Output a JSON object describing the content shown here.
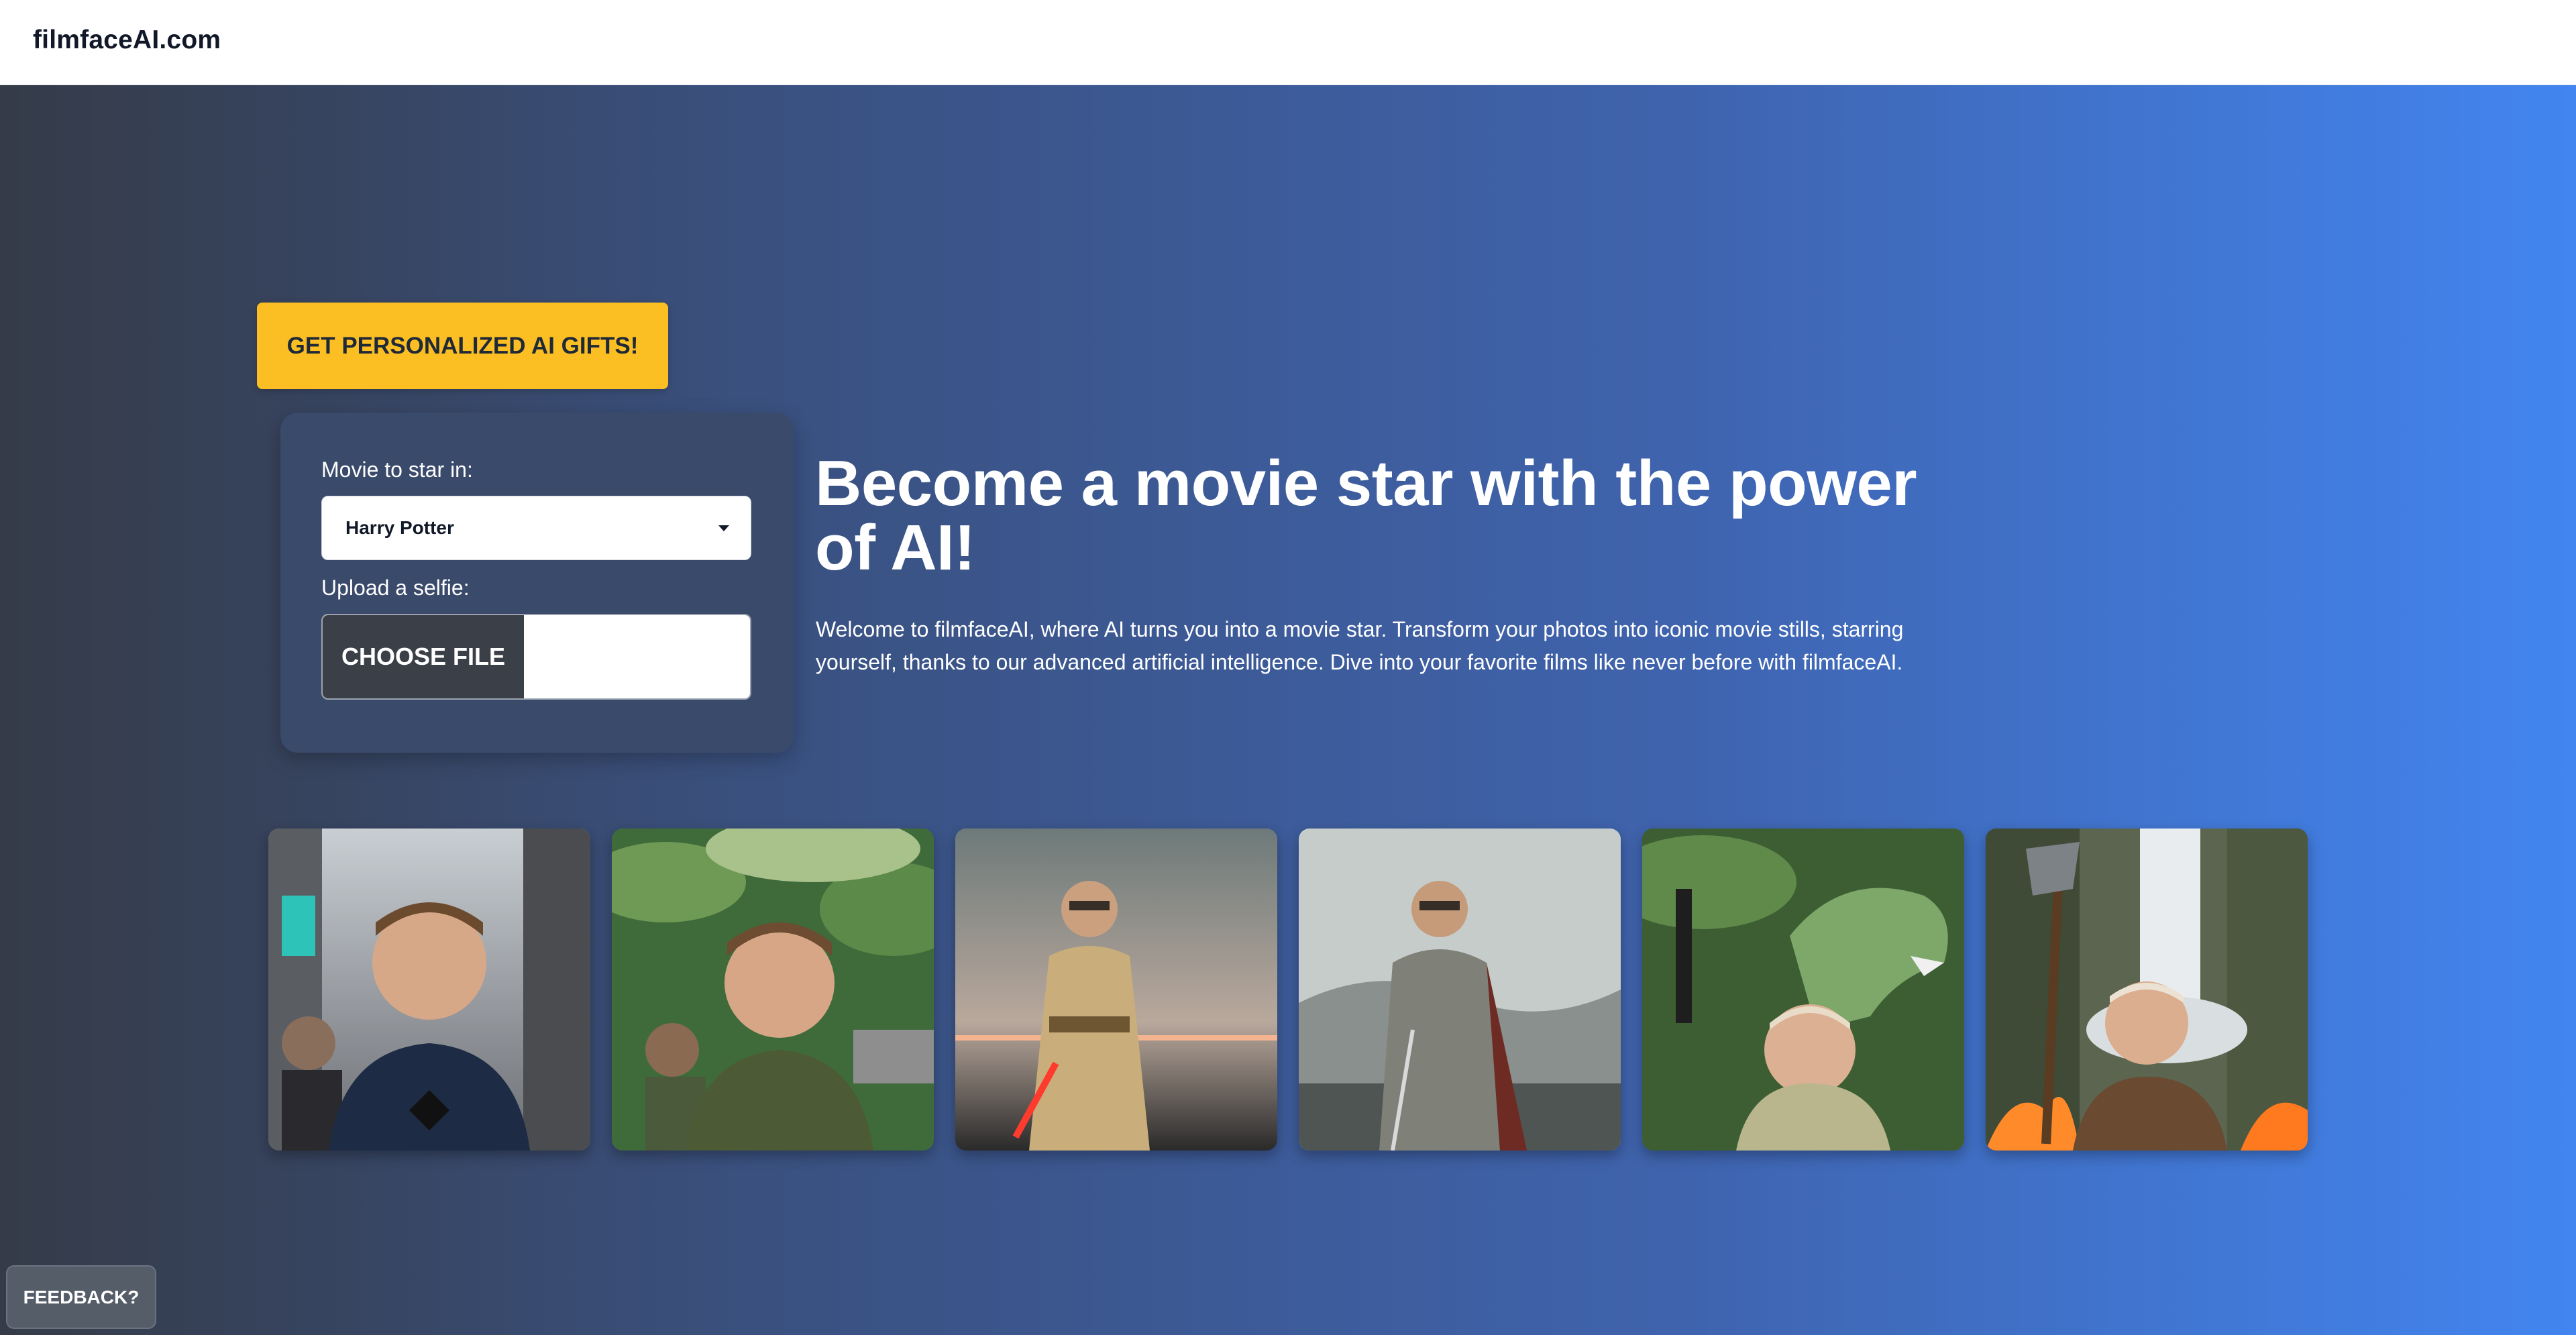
{
  "brand": "filmfaceAI.com",
  "gift_button": "GET PERSONALIZED AI GIFTS!",
  "form": {
    "movie_label": "Movie to star in:",
    "movie_selected": "Harry Potter",
    "selfie_label": "Upload a selfie:",
    "choose_file": "CHOOSE FILE"
  },
  "hero": {
    "title": "Become a movie star with the power of AI!",
    "intro": "Welcome to filmfaceAI, where AI turns you into a movie star. Transform your photos into iconic movie stills, starring yourself, thanks to our advanced artificial intelligence. Dive into your favorite films like never before with filmfaceAI."
  },
  "feedback": "FEEDBACK?",
  "colors": {
    "accent": "#fbbf24",
    "gradient_start": "#353b48",
    "gradient_end": "#4285f0"
  },
  "gallery_icons": [
    "city-crowd-portrait",
    "jungle-portrait",
    "jedi-lightsaber-portrait",
    "armored-knight-portrait",
    "dinosaur-blaster-portrait",
    "waterfall-axe-portrait"
  ]
}
